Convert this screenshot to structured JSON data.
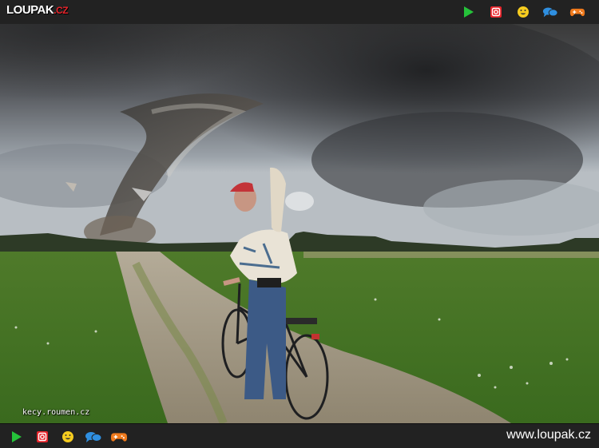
{
  "header": {
    "logo_main": "LOUPAK",
    "logo_tld": ".CZ",
    "icons": [
      "play-icon",
      "instagram-icon",
      "smiley-icon",
      "chat-icon",
      "gamepad-icon"
    ]
  },
  "photo": {
    "watermark": "kecy.roumen.cz"
  },
  "footer": {
    "icons": [
      "play-icon",
      "instagram-icon",
      "smiley-icon",
      "chat-icon",
      "gamepad-icon"
    ],
    "site_url": "www.loupak.cz"
  },
  "colors": {
    "play": "#25c23a",
    "instagram": "#e8242b",
    "smiley": "#f6cc1f",
    "chat": "#2f8fe0",
    "gamepad": "#f07a1c"
  }
}
